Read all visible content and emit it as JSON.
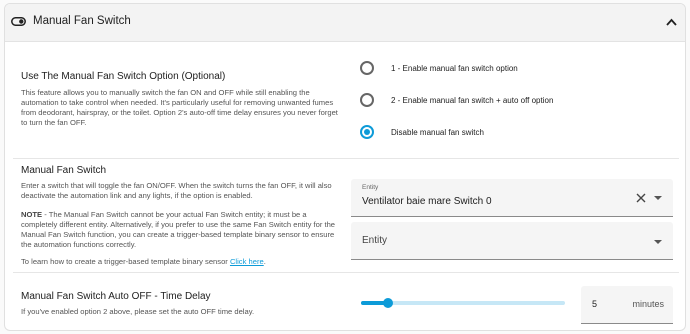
{
  "header": {
    "icon": "toggle-switch-icon",
    "title": "Manual Fan Switch",
    "chevron_icon": "chevron-up-icon"
  },
  "option_section": {
    "title": "Use The Manual Fan Switch Option (Optional)",
    "description": "This feature allows you to manually switch the fan ON and OFF while still enabling the automation to take control when needed. It's particularly useful for removing unwanted fumes from deodorant, hairspray, or the toilet. Option 2's auto-off time delay ensures you never forget to turn the fan OFF.",
    "options": [
      {
        "label": "1 - Enable manual fan switch option",
        "checked": false
      },
      {
        "label": "2 - Enable manual fan switch + auto off option",
        "checked": false
      },
      {
        "label": "Disable manual fan switch",
        "checked": true
      }
    ]
  },
  "switch_section": {
    "title": "Manual Fan Switch",
    "description": "Enter a switch that will toggle the fan ON/OFF. When the switch turns the fan OFF, it will also deactivate the automation link and any lights, if the option is enabled.",
    "note_label": "NOTE",
    "note_text": " - The Manual Fan Switch cannot be your actual Fan Switch entity; it must be a completely different entity. Alternatively, if you prefer to use the same Fan Switch entity for the Manual Fan Switch function, you can create a trigger-based template binary sensor to ensure the automation functions correctly.",
    "learn_text": "To learn how to create a trigger-based template binary sensor ",
    "link_text": "Click here",
    "learn_end": ".",
    "entity_field": {
      "label": "Entity",
      "value": "Ventilator baie mare Switch 0",
      "clear_icon": "close-icon",
      "caret_icon": "caret-down-icon"
    },
    "empty_field": {
      "placeholder": "Entity",
      "caret_icon": "caret-down-icon"
    }
  },
  "delay_section": {
    "title": "Manual Fan Switch Auto OFF - Time Delay",
    "description": "If you've enabled option 2 above, please set the auto OFF time delay.",
    "slider_fraction": 0.13,
    "value": "5",
    "unit": "minutes"
  },
  "colors": {
    "accent": "#0d9bd8",
    "header_bg": "#f3f3f3",
    "field_bg": "#f5f5f5"
  }
}
